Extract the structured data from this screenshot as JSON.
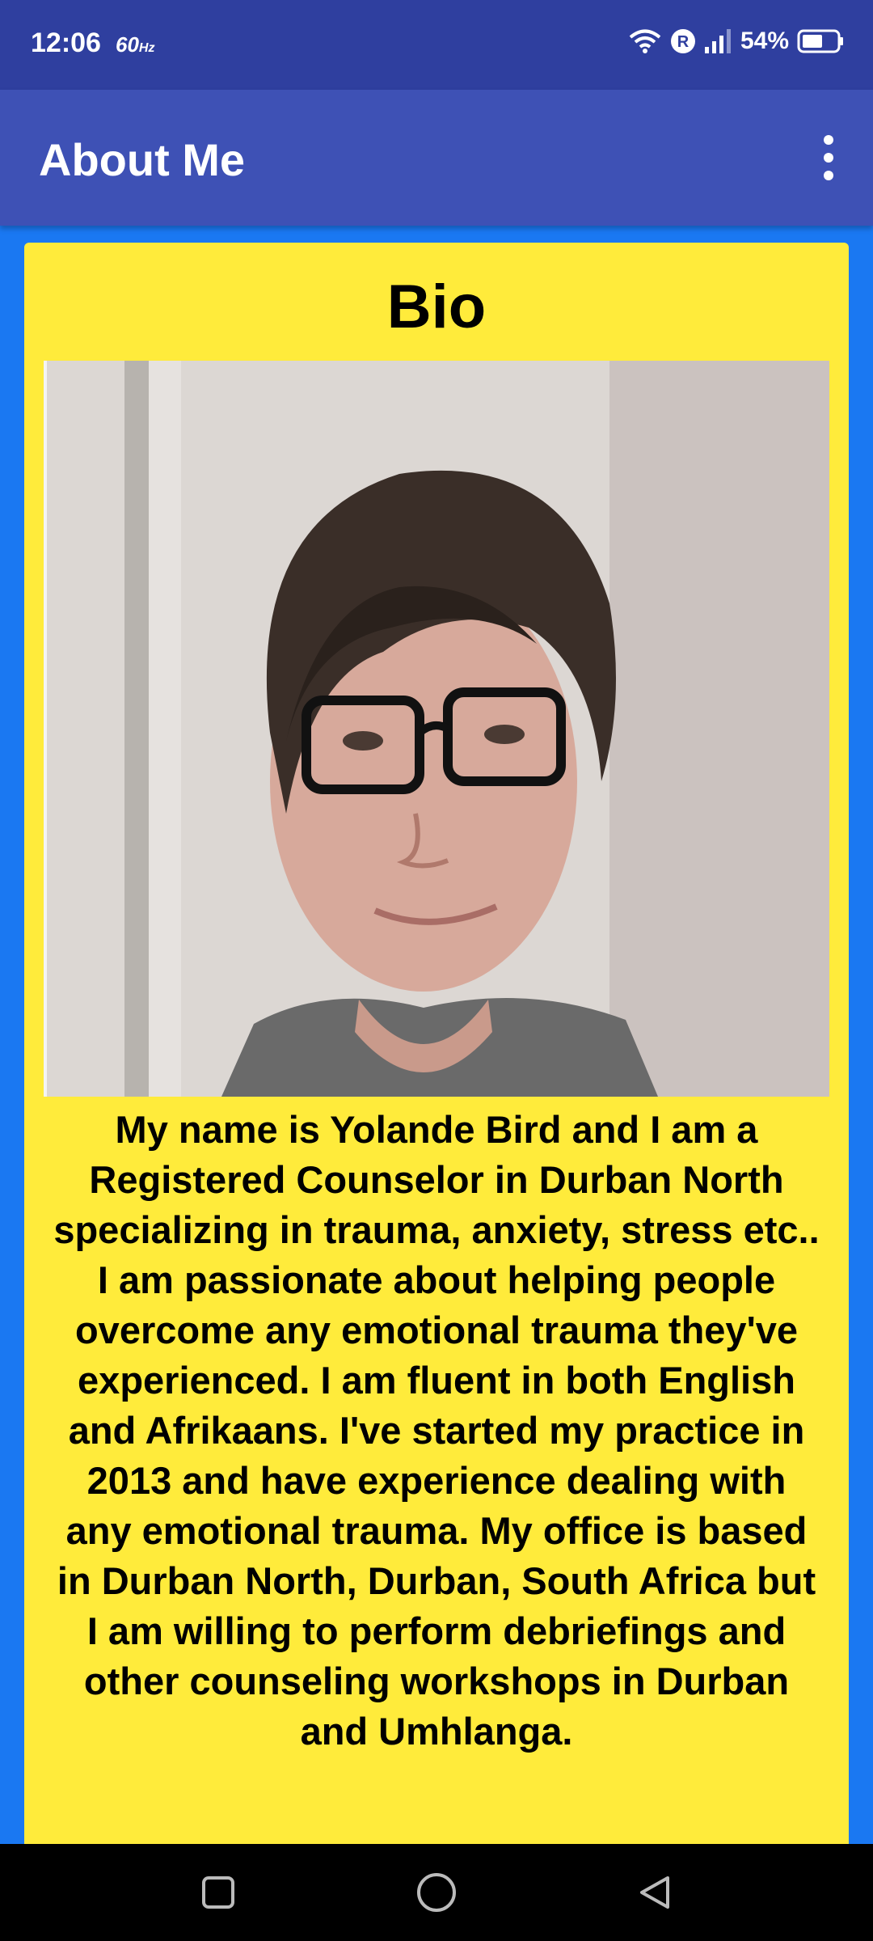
{
  "status_bar": {
    "time": "12:06",
    "refresh_rate": "60",
    "refresh_unit": "Hz",
    "battery": "54%",
    "icons": [
      "wifi-icon",
      "roaming-icon",
      "signal-icon",
      "battery-icon"
    ]
  },
  "app_bar": {
    "title": "About Me",
    "menu_icon": "more-vert-icon"
  },
  "card": {
    "title": "Bio",
    "photo": "profile-photo",
    "bio_text": "My name is Yolande Bird and I am a Registered Counselor in Durban North specializing in trauma, anxiety, stress etc.. I am passionate about helping people overcome any emotional trauma they've experienced. I am fluent in both English and Afrikaans. I've started my practice in 2013 and have experience dealing with any emotional trauma. My office is based in Durban North, Durban, South Africa but I am willing to perform debriefings and other counseling workshops in Durban and Umhlanga."
  },
  "nav_bar": {
    "icons": [
      "recents-icon",
      "home-icon",
      "back-icon"
    ]
  },
  "colors": {
    "status_bar": "#2f3f9f",
    "app_bar": "#3e51b5",
    "background": "#1a78f2",
    "card": "#ffeb3b"
  }
}
